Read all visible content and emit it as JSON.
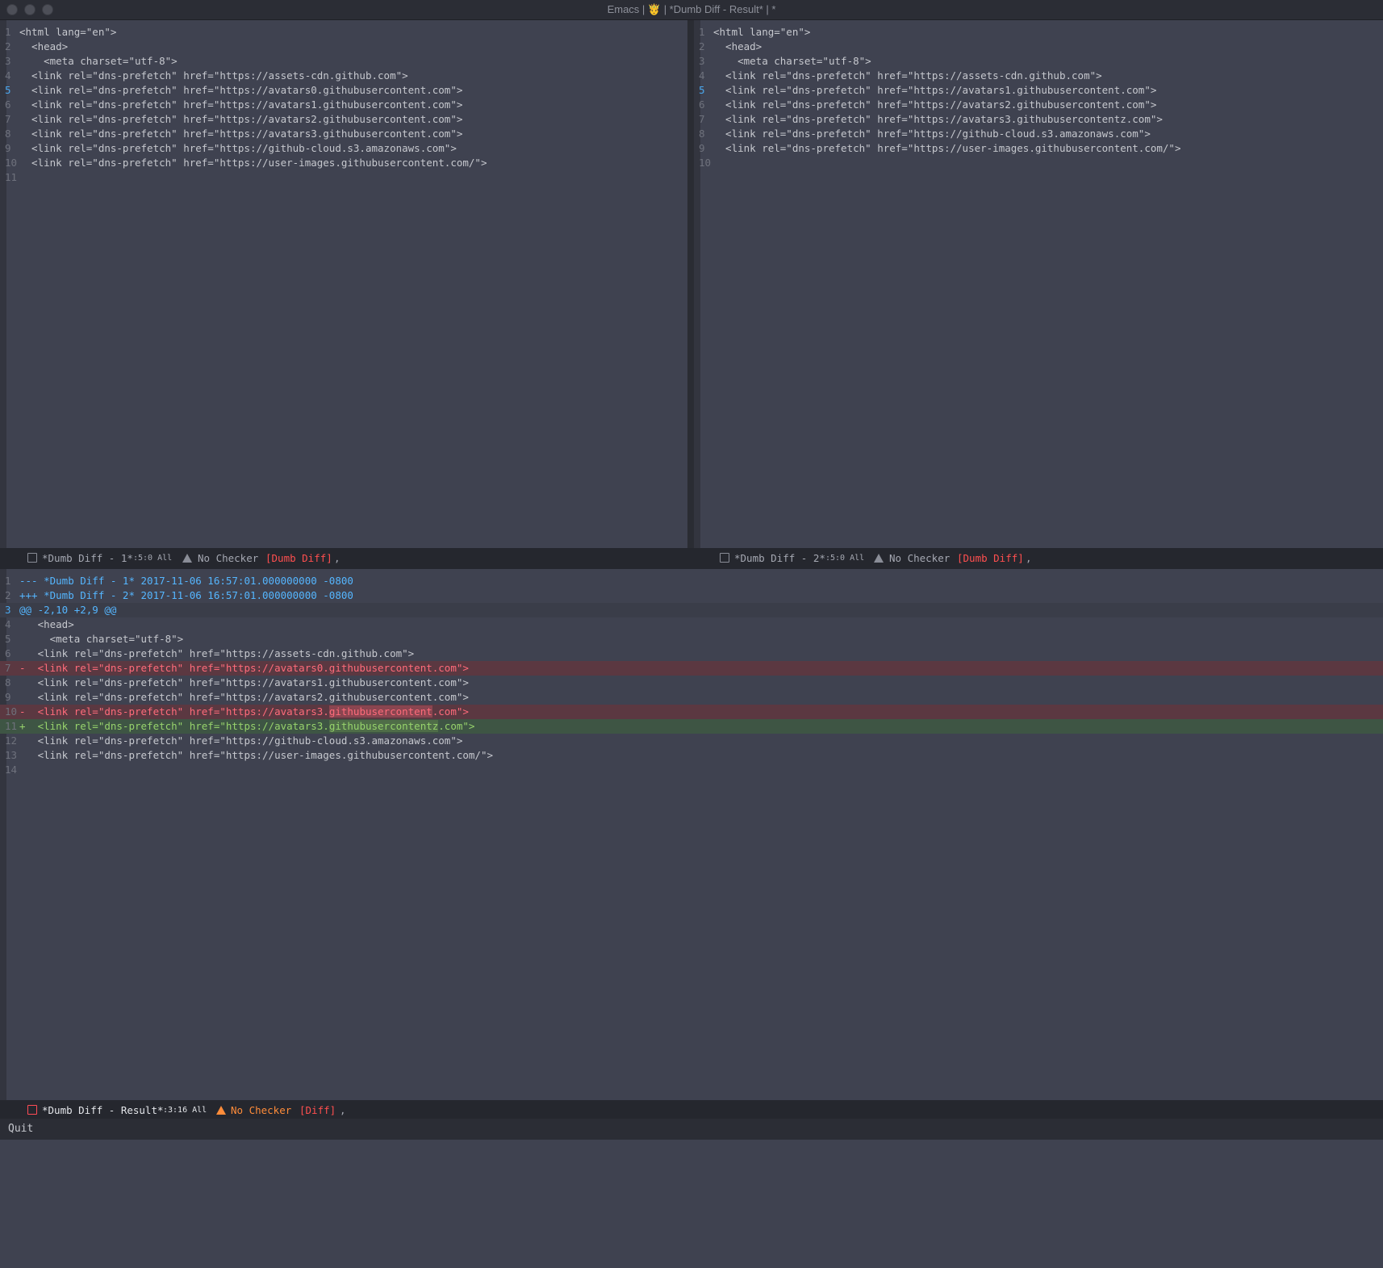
{
  "window": {
    "title": "Emacs | 🤴 | *Dumb Diff - Result* | *"
  },
  "left_pane": {
    "current_line": 5,
    "lines": [
      {
        "n": "1",
        "text": "<html lang=\"en\">"
      },
      {
        "n": "2",
        "text": "  <head>"
      },
      {
        "n": "3",
        "text": "    <meta charset=\"utf-8\">"
      },
      {
        "n": "4",
        "text": "  <link rel=\"dns-prefetch\" href=\"https://assets-cdn.github.com\">"
      },
      {
        "n": "5",
        "text": "  <link rel=\"dns-prefetch\" href=\"https://avatars0.githubusercontent.com\">"
      },
      {
        "n": "6",
        "text": "  <link rel=\"dns-prefetch\" href=\"https://avatars1.githubusercontent.com\">"
      },
      {
        "n": "7",
        "text": "  <link rel=\"dns-prefetch\" href=\"https://avatars2.githubusercontent.com\">"
      },
      {
        "n": "8",
        "text": "  <link rel=\"dns-prefetch\" href=\"https://avatars3.githubusercontent.com\">"
      },
      {
        "n": "9",
        "text": "  <link rel=\"dns-prefetch\" href=\"https://github-cloud.s3.amazonaws.com\">"
      },
      {
        "n": "10",
        "text": "  <link rel=\"dns-prefetch\" href=\"https://user-images.githubusercontent.com/\">"
      },
      {
        "n": "11",
        "text": ""
      }
    ],
    "modeline": {
      "buffer": "*Dumb Diff - 1*",
      "position": ":5:0 All",
      "checker": "No Checker",
      "mode": "[Dumb Diff]",
      "suffix": ","
    }
  },
  "right_pane": {
    "current_line": 5,
    "lines": [
      {
        "n": "1",
        "text": "<html lang=\"en\">"
      },
      {
        "n": "2",
        "text": "  <head>"
      },
      {
        "n": "3",
        "text": "    <meta charset=\"utf-8\">"
      },
      {
        "n": "4",
        "text": "  <link rel=\"dns-prefetch\" href=\"https://assets-cdn.github.com\">"
      },
      {
        "n": "5",
        "text": "  <link rel=\"dns-prefetch\" href=\"https://avatars1.githubusercontent.com\">"
      },
      {
        "n": "6",
        "text": "  <link rel=\"dns-prefetch\" href=\"https://avatars2.githubusercontent.com\">"
      },
      {
        "n": "7",
        "text": "  <link rel=\"dns-prefetch\" href=\"https://avatars3.githubusercontentz.com\">"
      },
      {
        "n": "8",
        "text": "  <link rel=\"dns-prefetch\" href=\"https://github-cloud.s3.amazonaws.com\">"
      },
      {
        "n": "9",
        "text": "  <link rel=\"dns-prefetch\" href=\"https://user-images.githubusercontent.com/\">"
      },
      {
        "n": "10",
        "text": ""
      }
    ],
    "modeline": {
      "buffer": "*Dumb Diff - 2*",
      "position": ":5:0 All",
      "checker": "No Checker",
      "mode": "[Dumb Diff]",
      "suffix": ","
    }
  },
  "diff_pane": {
    "current_line": 3,
    "lines": [
      {
        "n": "1",
        "kind": "header",
        "text": "--- *Dumb Diff - 1* 2017-11-06 16:57:01.000000000 -0800"
      },
      {
        "n": "2",
        "kind": "header",
        "text": "+++ *Dumb Diff - 2* 2017-11-06 16:57:01.000000000 -0800"
      },
      {
        "n": "3",
        "kind": "hunk",
        "text": "@@ -2,10 +2,9 @@"
      },
      {
        "n": "4",
        "kind": "context",
        "text": "   <head>"
      },
      {
        "n": "5",
        "kind": "context",
        "text": "     <meta charset=\"utf-8\">"
      },
      {
        "n": "6",
        "kind": "context",
        "text": "   <link rel=\"dns-prefetch\" href=\"https://assets-cdn.github.com\">"
      },
      {
        "n": "7",
        "kind": "del",
        "pre": "-  <link rel=\"dns-prefetch\" href=\"https://avatars0.githubusercontent.com\">",
        "hl": "",
        "post": ""
      },
      {
        "n": "8",
        "kind": "context",
        "text": "   <link rel=\"dns-prefetch\" href=\"https://avatars1.githubusercontent.com\">"
      },
      {
        "n": "9",
        "kind": "context",
        "text": "   <link rel=\"dns-prefetch\" href=\"https://avatars2.githubusercontent.com\">"
      },
      {
        "n": "10",
        "kind": "del",
        "pre": "-  <link rel=\"dns-prefetch\" href=\"https://avatars3.",
        "hl": "githubusercontent",
        "post": ".com\">"
      },
      {
        "n": "11",
        "kind": "add",
        "pre": "+  <link rel=\"dns-prefetch\" href=\"https://avatars3.",
        "hl": "githubusercontentz",
        "post": ".com\">"
      },
      {
        "n": "12",
        "kind": "context",
        "text": "   <link rel=\"dns-prefetch\" href=\"https://github-cloud.s3.amazonaws.com\">"
      },
      {
        "n": "13",
        "kind": "context",
        "text": "   <link rel=\"dns-prefetch\" href=\"https://user-images.githubusercontent.com/\">"
      },
      {
        "n": "14",
        "kind": "context",
        "text": ""
      }
    ],
    "modeline": {
      "buffer": "*Dumb Diff - Result*",
      "position": ":3:16 All",
      "checker": "No Checker",
      "mode": "[Diff]",
      "suffix": ","
    }
  },
  "minibuffer": {
    "message": "Quit"
  },
  "colors": {
    "background": "#3f4250",
    "deleted_line": "#5b3841",
    "added_line": "#3e5544",
    "header_text": "#55b6ff",
    "mode_red": "#ff4f4f",
    "warning_orange": "#ff8c3a"
  },
  "icons": {
    "save": "floppy-disk-icon",
    "checker": "warning-triangle-icon"
  }
}
